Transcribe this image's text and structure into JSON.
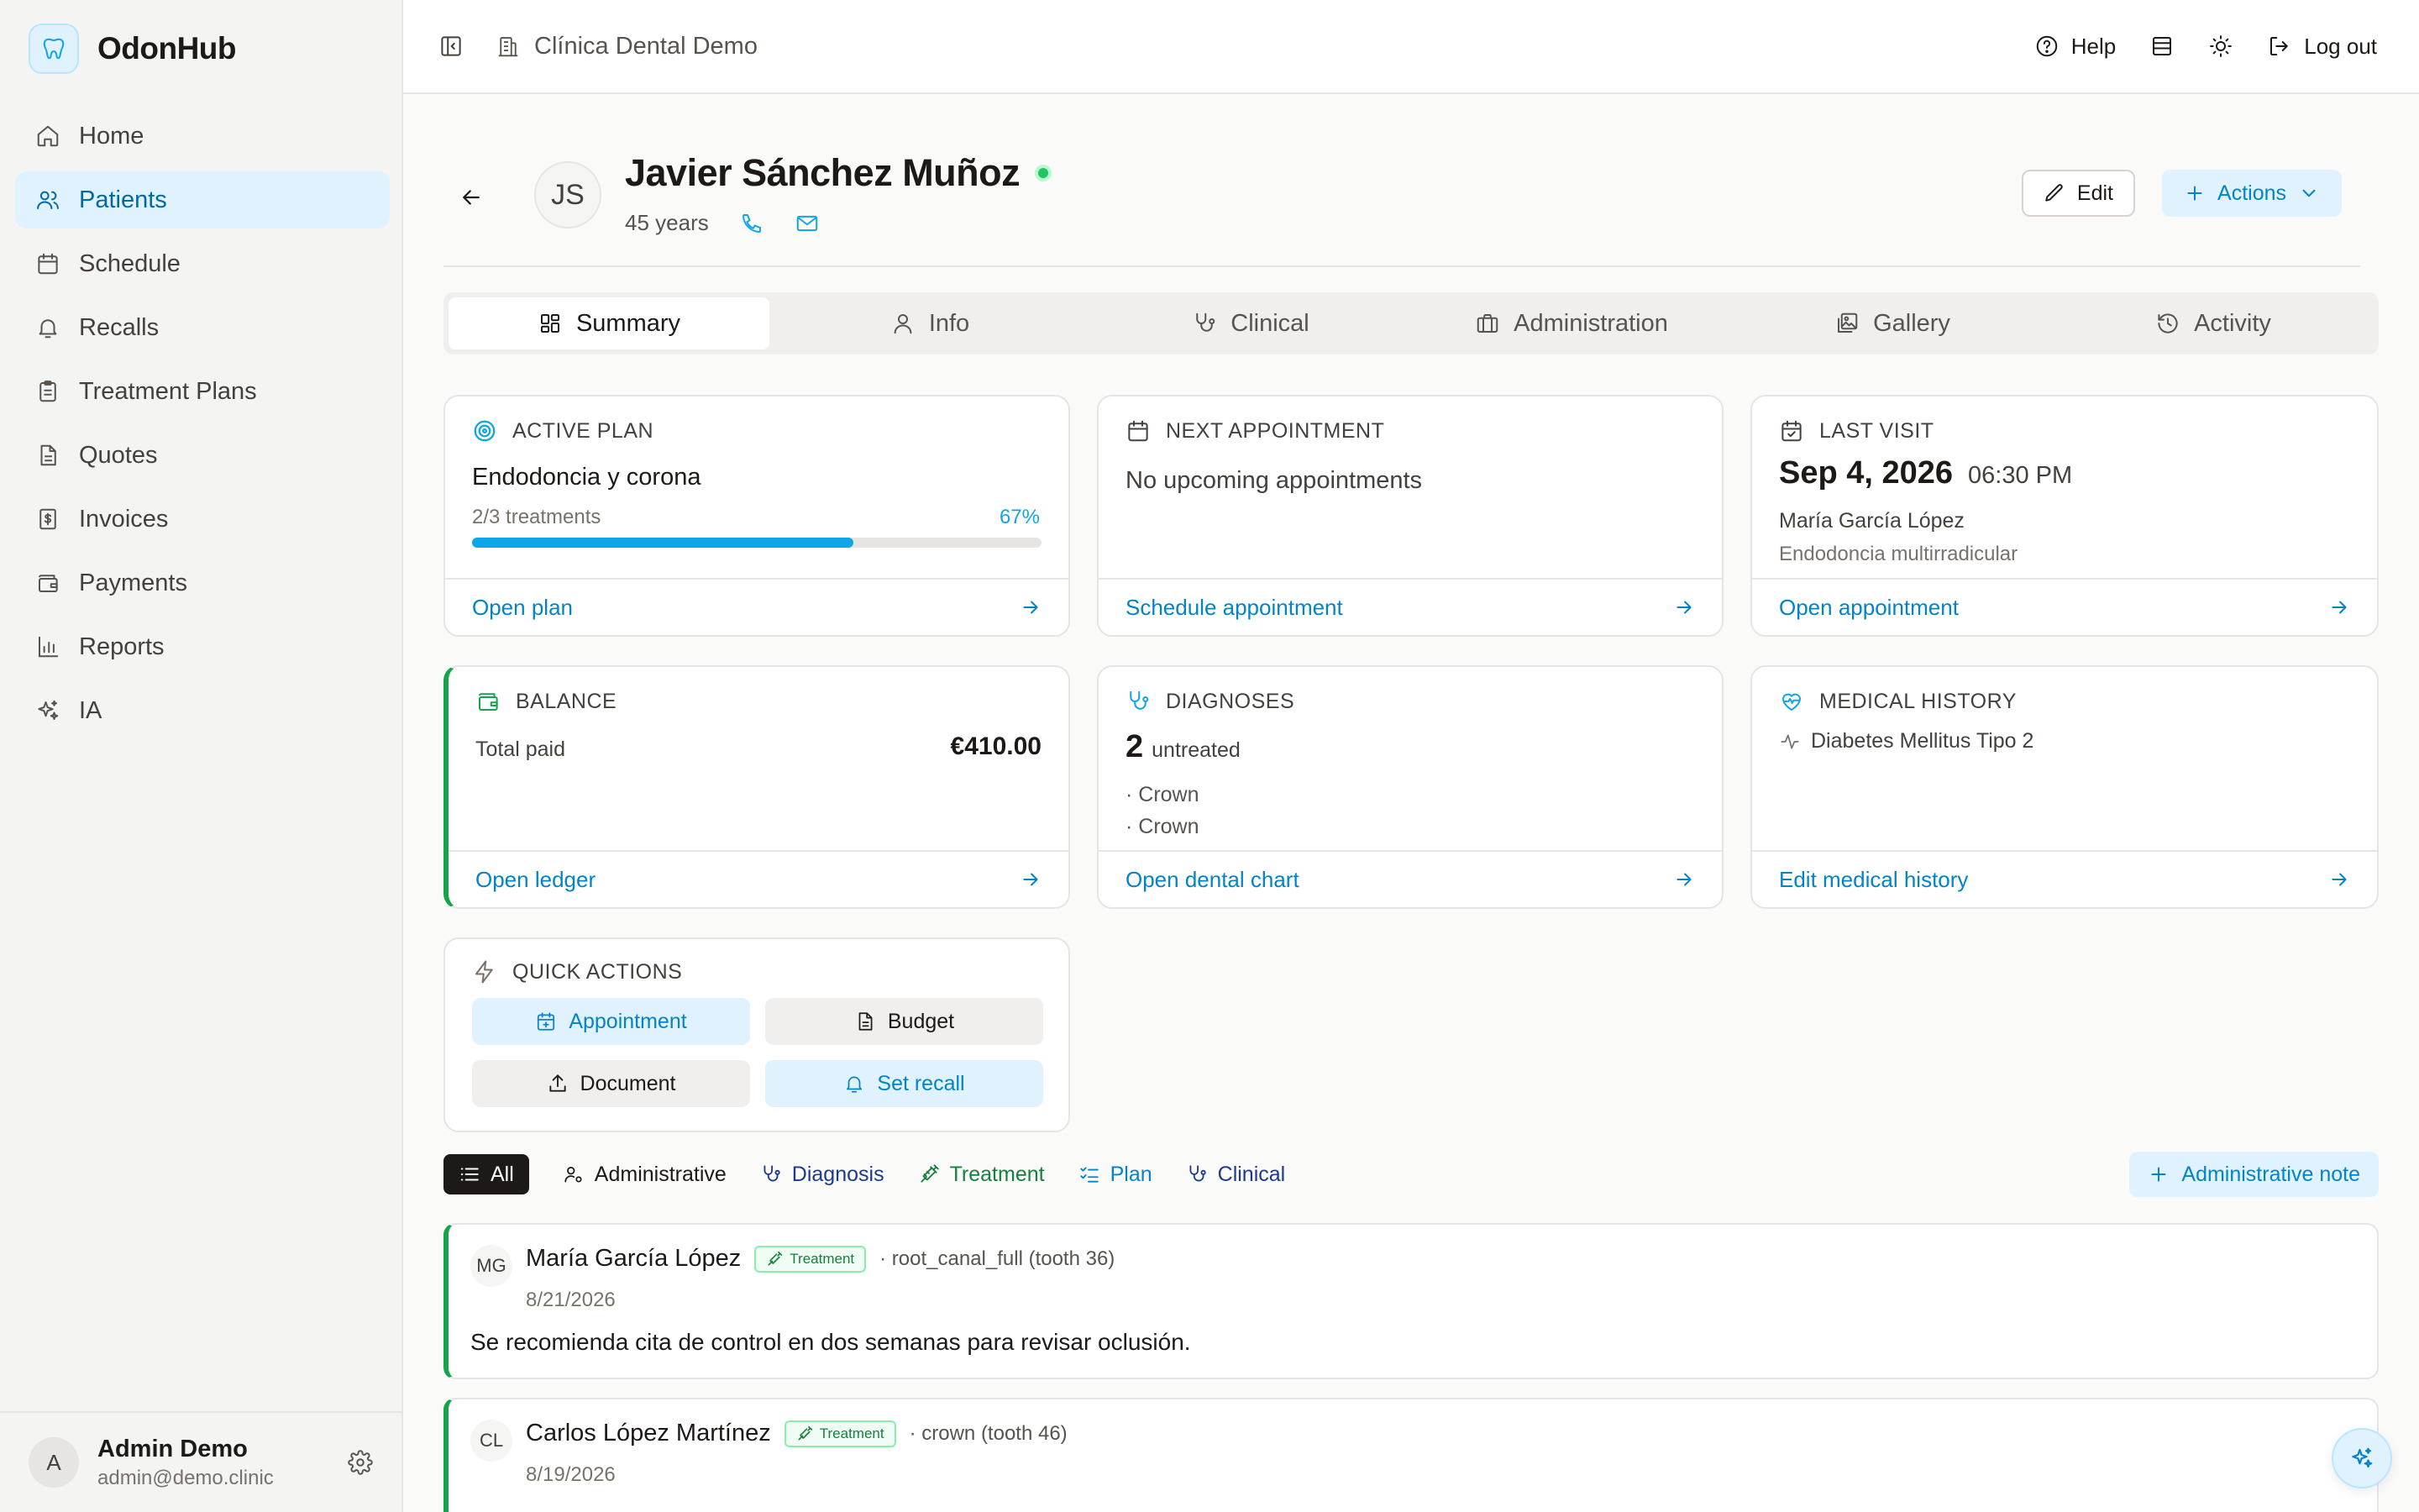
{
  "brand": {
    "name": "OdonHub",
    "icon": "tooth-icon",
    "accent": "#0ea5e9"
  },
  "sidebar": {
    "items": [
      {
        "label": "Home",
        "icon": "home-icon"
      },
      {
        "label": "Patients",
        "icon": "users-icon",
        "active": true
      },
      {
        "label": "Schedule",
        "icon": "calendar-icon"
      },
      {
        "label": "Recalls",
        "icon": "bell-icon"
      },
      {
        "label": "Treatment Plans",
        "icon": "clipboard-icon"
      },
      {
        "label": "Quotes",
        "icon": "document-icon"
      },
      {
        "label": "Invoices",
        "icon": "invoice-icon"
      },
      {
        "label": "Payments",
        "icon": "wallet-icon"
      },
      {
        "label": "Reports",
        "icon": "bar-chart-icon"
      },
      {
        "label": "IA",
        "icon": "sparkles-icon"
      }
    ],
    "user": {
      "initial": "A",
      "name": "Admin Demo",
      "email": "admin@demo.clinic"
    }
  },
  "topbar": {
    "clinic": "Clínica Dental Demo",
    "help": "Help",
    "logout": "Log out"
  },
  "patient": {
    "initials": "JS",
    "name": "Javier Sánchez Muñoz",
    "age": "45 years",
    "status_color": "#22c55e",
    "edit": "Edit",
    "actions": "Actions"
  },
  "tabs": [
    {
      "label": "Summary",
      "icon": "dashboard-icon",
      "active": true
    },
    {
      "label": "Info",
      "icon": "user-icon"
    },
    {
      "label": "Clinical",
      "icon": "stethoscope-icon"
    },
    {
      "label": "Administration",
      "icon": "briefcase-icon"
    },
    {
      "label": "Gallery",
      "icon": "gallery-icon"
    },
    {
      "label": "Activity",
      "icon": "history-icon"
    }
  ],
  "cards": {
    "active_plan": {
      "title": "ACTIVE PLAN",
      "name": "Endodoncia y corona",
      "progress_text": "2/3 treatments",
      "percent_text": "67%",
      "percent": 67,
      "link": "Open plan"
    },
    "next_appointment": {
      "title": "NEXT APPOINTMENT",
      "text": "No upcoming appointments",
      "link": "Schedule appointment"
    },
    "last_visit": {
      "title": "LAST VISIT",
      "date": "Sep 4, 2026",
      "time": "06:30 PM",
      "doctor": "María García López",
      "treatment": "Endodoncia multirradicular",
      "link": "Open appointment"
    },
    "balance": {
      "title": "BALANCE",
      "label": "Total paid",
      "amount": "€410.00",
      "link": "Open ledger"
    },
    "diagnoses": {
      "title": "DIAGNOSES",
      "count": "2",
      "count_label": "untreated",
      "items": [
        "· Crown",
        "· Crown"
      ],
      "link": "Open dental chart"
    },
    "medical_history": {
      "title": "MEDICAL HISTORY",
      "item": "Diabetes Mellitus Tipo 2",
      "link": "Edit medical history"
    },
    "quick_actions": {
      "title": "QUICK ACTIONS",
      "appointment": "Appointment",
      "budget": "Budget",
      "document": "Document",
      "recall": "Set recall"
    }
  },
  "filters": {
    "all": "All",
    "administrative": "Administrative",
    "diagnosis": "Diagnosis",
    "treatment": "Treatment",
    "plan": "Plan",
    "clinical": "Clinical",
    "admin_note": "Administrative note",
    "colors": {
      "diagnosis": "#1e3a8a",
      "treatment": "#15803d",
      "plan": "#0284c7",
      "clinical": "#1e3a8a"
    }
  },
  "timeline": [
    {
      "initials": "MG",
      "author": "María García López",
      "badge": "Treatment",
      "detail": "· root_canal_full (tooth 36)",
      "date": "8/21/2026",
      "note": "Se recomienda cita de control en dos semanas para revisar oclusión."
    },
    {
      "initials": "CL",
      "author": "Carlos López Martínez",
      "badge": "Treatment",
      "detail": "· crown (tooth 46)",
      "date": "8/19/2026",
      "note": ""
    }
  ]
}
